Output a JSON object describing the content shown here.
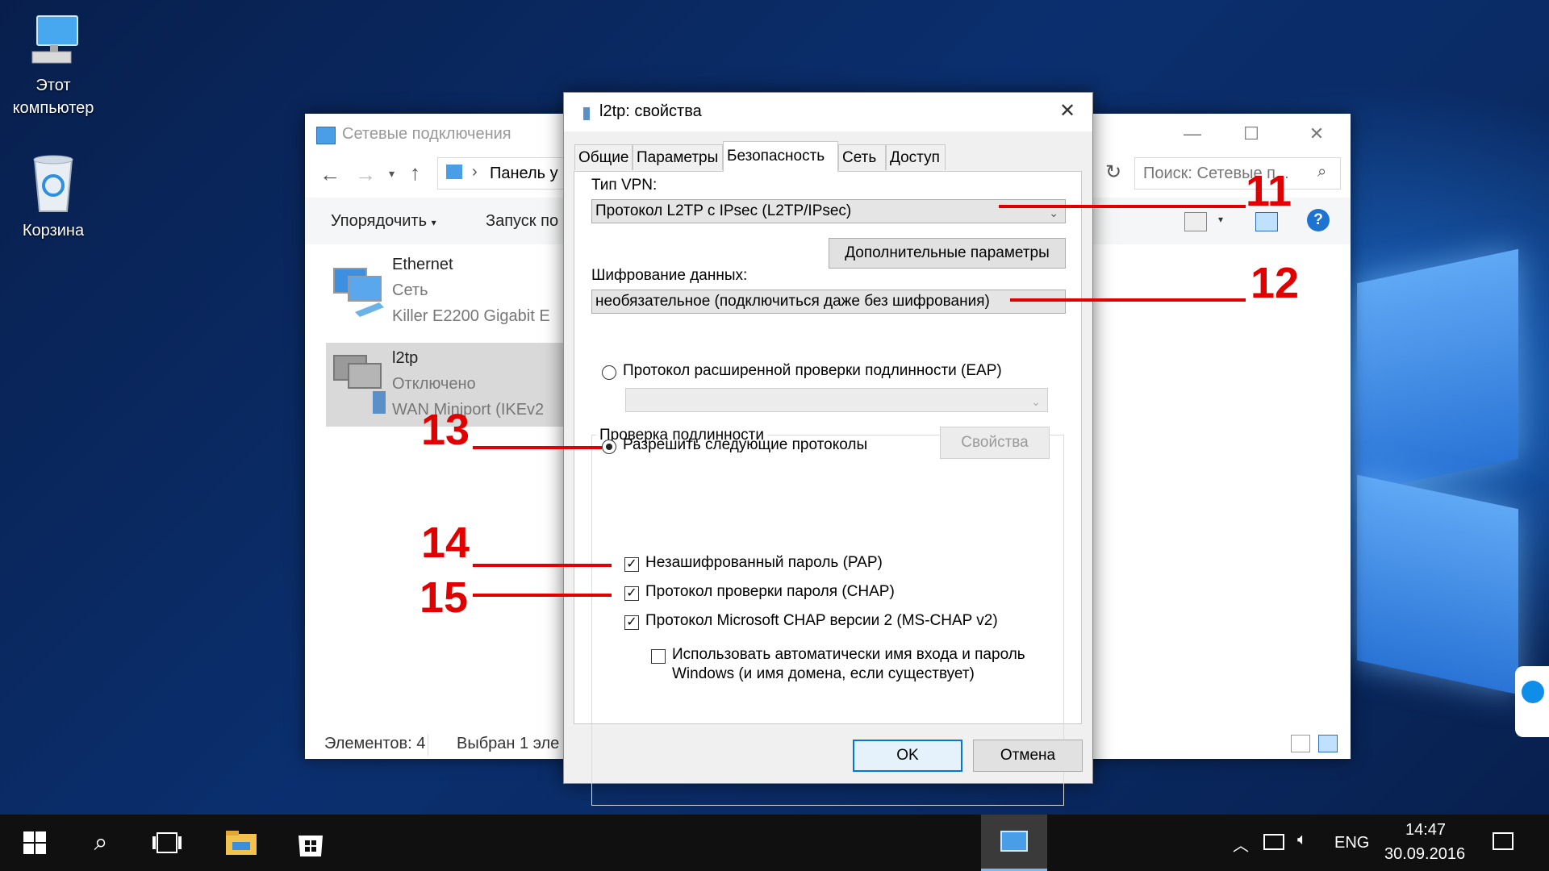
{
  "desktop": {
    "icons": [
      {
        "label_line1": "Этот",
        "label_line2": "компьютер"
      },
      {
        "label_line1": "Корзина"
      }
    ]
  },
  "explorer": {
    "title": "Сетевые подключения",
    "address": "Панель у",
    "search_placeholder": "Поиск: Сетевые п...",
    "toolbar": {
      "organize": "Упорядочить",
      "launch": "Запуск по"
    },
    "items": [
      {
        "name": "Ethernet",
        "status": "Сеть",
        "adapter": "Killer E2200 Gigabit E"
      },
      {
        "name": "l2tp",
        "status": "Отключено",
        "adapter": "WAN Miniport (IKEv2"
      }
    ],
    "statusbar": {
      "count": "Элементов: 4",
      "selected": "Выбран 1 эле"
    }
  },
  "dialog": {
    "title": "l2tp: свойства",
    "tabs": [
      "Общие",
      "Параметры",
      "Безопасность",
      "Сеть",
      "Доступ"
    ],
    "active_tab": "Безопасность",
    "vpn_type_label": "Тип VPN:",
    "vpn_type_value": "Протокол L2TP с IPsec (L2TP/IPsec)",
    "advanced_button": "Дополнительные параметры",
    "encryption_label": "Шифрование данных:",
    "encryption_value": "необязательное (подключиться даже без шифрования)",
    "auth_group_title": "Проверка подлинности",
    "eap_radio": "Протокол расширенной проверки подлинности (EAP)",
    "allow_radio": "Разрешить следующие протоколы",
    "properties_button": "Свойства",
    "pap": "Незашифрованный пароль (PAP)",
    "chap": "Протокол проверки пароля (CHAP)",
    "mschap": "Протокол Microsoft CHAP версии 2 (MS-CHAP v2)",
    "auto_login_line1": "Использовать автоматически имя входа и пароль",
    "auto_login_line2": "Windows (и имя домена, если существует)",
    "ok": "OK",
    "cancel": "Отмена"
  },
  "annotations": [
    "11",
    "12",
    "13",
    "14",
    "15"
  ],
  "taskbar": {
    "lang": "ENG",
    "time": "14:47",
    "date": "30.09.2016"
  },
  "colors": {
    "annotation": "#e00000",
    "accent": "#0078d7"
  }
}
